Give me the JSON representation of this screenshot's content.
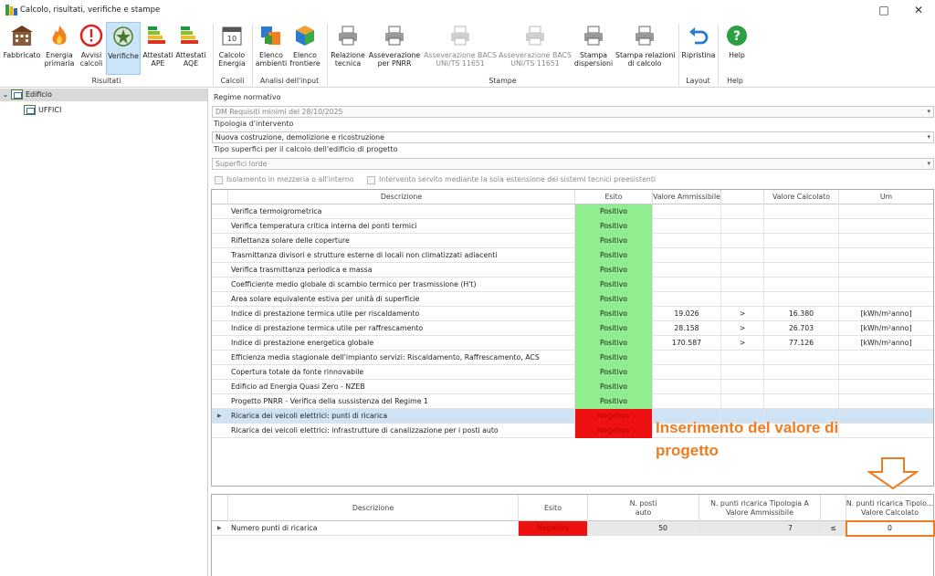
{
  "window": {
    "title": "Calcolo, risultati, verifiche e stampe",
    "minimize": "□",
    "close": "✕"
  },
  "ribbon": {
    "buttons": [
      {
        "label1": "Fabbricato",
        "label2": ""
      },
      {
        "label1": "Energia",
        "label2": "primaria"
      },
      {
        "label1": "Avvisi",
        "label2": "calcoli"
      },
      {
        "label1": "Verifiche",
        "label2": ""
      },
      {
        "label1": "Attestati",
        "label2": "APE"
      },
      {
        "label1": "Attestati",
        "label2": "AQE"
      },
      {
        "label1": "Calcolo",
        "label2": "Energia"
      },
      {
        "label1": "Elenco",
        "label2": "ambienti"
      },
      {
        "label1": "Elenco",
        "label2": "frontiere"
      },
      {
        "label1": "Relazione",
        "label2": "tecnica"
      },
      {
        "label1": "Asseverazione",
        "label2": "per PNRR"
      },
      {
        "label1": "Asseverazione BACS",
        "label2": "UNI/TS 11651"
      },
      {
        "label1": "Asseverazione BACS",
        "label2": "UNI/TS 11651"
      },
      {
        "label1": "Stampa",
        "label2": "dispersioni"
      },
      {
        "label1": "Stampa relazioni",
        "label2": "di calcolo"
      },
      {
        "label1": "Ripristina",
        "label2": ""
      },
      {
        "label1": "Help",
        "label2": ""
      }
    ],
    "groups": [
      "Risultati",
      "Calcoli",
      "Analisi dell'input",
      "Stampe",
      "Layout",
      "Help"
    ]
  },
  "tree": {
    "root": "Edificio",
    "child": "UFFICI"
  },
  "form": {
    "regime_label": "Regime normativo",
    "regime_value": "DM Requisiti minimi del 28/10/2025",
    "tipologia_label": "Tipologia d'intervento",
    "tipologia_value": "Nuova costruzione, demolizione e ricostruzione",
    "superfici_label": "Tipo superfici per il calcolo dell'edificio di progetto",
    "superfici_value": "Superfici lorde",
    "chk1": "Isolamento in mezzeria o all'interno",
    "chk2": "Intervento servito mediante la sola estensione dei sistemi tecnici preesistenti"
  },
  "grid1": {
    "headers": [
      "Descrizione",
      "Esito",
      "Valore Ammissibile",
      "",
      "Valore Calcolato",
      "Um"
    ],
    "rows": [
      {
        "desc": "Verifica termoigrometrica",
        "esito": "Positivo",
        "amm": "",
        "op": "",
        "calc": "",
        "um": ""
      },
      {
        "desc": "Verifica temperatura critica interna dei ponti termici",
        "esito": "Positivo",
        "amm": "",
        "op": "",
        "calc": "",
        "um": ""
      },
      {
        "desc": "Riflettanza solare delle coperture",
        "esito": "Positivo",
        "amm": "",
        "op": "",
        "calc": "",
        "um": ""
      },
      {
        "desc": "Trasmittanza divisori e strutture esterne di locali non climatizzati adiacenti",
        "esito": "Positivo",
        "amm": "",
        "op": "",
        "calc": "",
        "um": ""
      },
      {
        "desc": "Verifica trasmittanza periodica e massa",
        "esito": "Positivo",
        "amm": "",
        "op": "",
        "calc": "",
        "um": ""
      },
      {
        "desc": "Coefficiente medio globale di scambio termico per trasmissione (H't)",
        "esito": "Positivo",
        "amm": "",
        "op": "",
        "calc": "",
        "um": ""
      },
      {
        "desc": "Area solare equivalente estiva per unità di superficie",
        "esito": "Positivo",
        "amm": "",
        "op": "",
        "calc": "",
        "um": ""
      },
      {
        "desc": "Indice di prestazione termica utile per riscaldamento",
        "esito": "Positivo",
        "amm": "19.026",
        "op": ">",
        "calc": "16.380",
        "um": "[kWh/m²anno]"
      },
      {
        "desc": "Indice di prestazione termica utile per raffrescamento",
        "esito": "Positivo",
        "amm": "28.158",
        "op": ">",
        "calc": "26.703",
        "um": "[kWh/m²anno]"
      },
      {
        "desc": "Indice di prestazione energetica globale",
        "esito": "Positivo",
        "amm": "170.587",
        "op": ">",
        "calc": "77.126",
        "um": "[kWh/m²anno]"
      },
      {
        "desc": "Efficienza media stagionale dell'impianto servizi: Riscaldamento, Raffrescamento, ACS",
        "esito": "Positivo",
        "amm": "",
        "op": "",
        "calc": "",
        "um": ""
      },
      {
        "desc": "Copertura totale da fonte rinnovabile",
        "esito": "Positivo",
        "amm": "",
        "op": "",
        "calc": "",
        "um": ""
      },
      {
        "desc": "Edificio ad Energia Quasi Zero - NZEB",
        "esito": "Positivo",
        "amm": "",
        "op": "",
        "calc": "",
        "um": ""
      },
      {
        "desc": "Progetto PNRR - Verifica della sussistenza del Regime 1",
        "esito": "Positivo",
        "amm": "",
        "op": "",
        "calc": "",
        "um": ""
      },
      {
        "desc": "Ricarica dei veicoli elettrici: punti di ricarica",
        "esito": "Negativo",
        "amm": "",
        "op": "",
        "calc": "",
        "um": ""
      },
      {
        "desc": "Ricarica dei veicoli elettrici: infrastrutture di canalizzazione per i posti auto",
        "esito": "Negativo",
        "amm": "",
        "op": "",
        "calc": "",
        "um": ""
      }
    ]
  },
  "annotation": {
    "line1": "Inserimento del valore di",
    "line2": "progetto"
  },
  "grid2": {
    "headers": [
      "Descrizione",
      "Esito",
      "N. posti\nauto",
      "N. punti ricarica Tipologia A\nValore Ammissibile",
      "",
      "N. punti ricarica Tipolo...\nValore Calcolato"
    ],
    "row": {
      "desc": "Numero punti di ricarica",
      "esito": "Negativo",
      "posti": "50",
      "amm": "7",
      "op": "≤",
      "calc": "0"
    }
  },
  "colors": {
    "positive": "#90ee90",
    "negative": "#ee1111",
    "annotation": "#ee7d22",
    "selection": "#cce4f7"
  }
}
